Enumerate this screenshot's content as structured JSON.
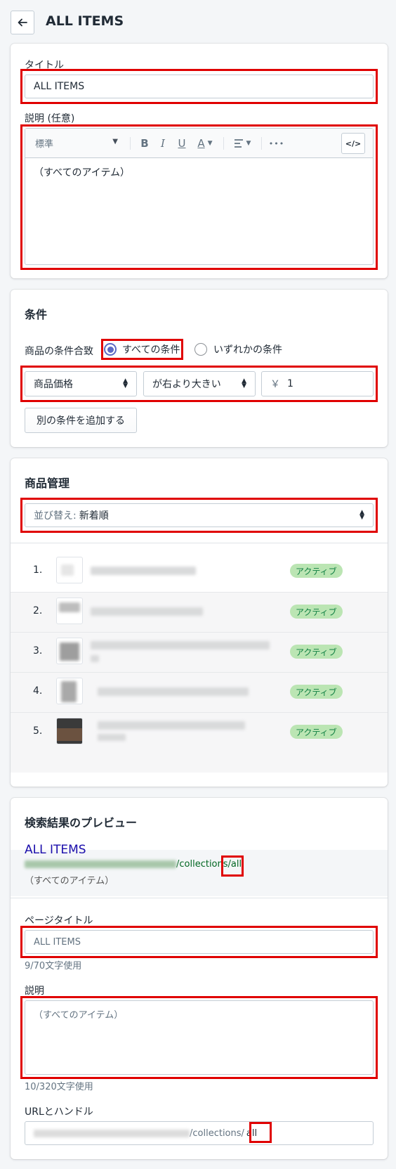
{
  "header": {
    "title": "ALL ITEMS"
  },
  "details": {
    "title_label": "タイトル",
    "title_value": "ALL ITEMS",
    "desc_label": "説明 (任意)",
    "toolbar": {
      "style": "標準",
      "bold": "B",
      "italic": "I",
      "underline": "U",
      "color": "A",
      "more": "•••",
      "code": "</>"
    },
    "desc_value": "（すべてのアイテム）"
  },
  "conditions": {
    "heading": "条件",
    "match_label": "商品の条件合致",
    "all_option": "すべての条件",
    "any_option": "いずれかの条件",
    "field": "商品価格",
    "operator": "が右より大きい",
    "currency": "￥",
    "value": "1",
    "add_button": "別の条件を追加する"
  },
  "products": {
    "heading": "商品管理",
    "sort_prefix": "並び替え:",
    "sort_value": "新着順",
    "items": [
      {
        "num": "1.",
        "status": "アクティブ"
      },
      {
        "num": "2.",
        "status": "アクティブ"
      },
      {
        "num": "3.",
        "status": "アクティブ"
      },
      {
        "num": "4.",
        "status": "アクティブ"
      },
      {
        "num": "5.",
        "status": "アクティブ"
      }
    ]
  },
  "seo": {
    "heading": "検索結果のプレビュー",
    "preview_title": "ALL ITEMS",
    "preview_path": "/collections/",
    "preview_handle": "all",
    "preview_desc": "（すべてのアイテム）",
    "page_title_label": "ページタイトル",
    "page_title_value": "ALL ITEMS",
    "page_title_count": "9/70文字使用",
    "desc_label": "説明",
    "desc_value": "（すべてのアイテム）",
    "desc_count": "10/320文字使用",
    "url_label": "URLとハンドル",
    "url_path": "/collections/",
    "url_handle": "all"
  },
  "colors": {
    "accent": "#5c6ac4",
    "highlight": "#e00000",
    "badge_bg": "#bbe5b3",
    "badge_text": "#108043"
  }
}
